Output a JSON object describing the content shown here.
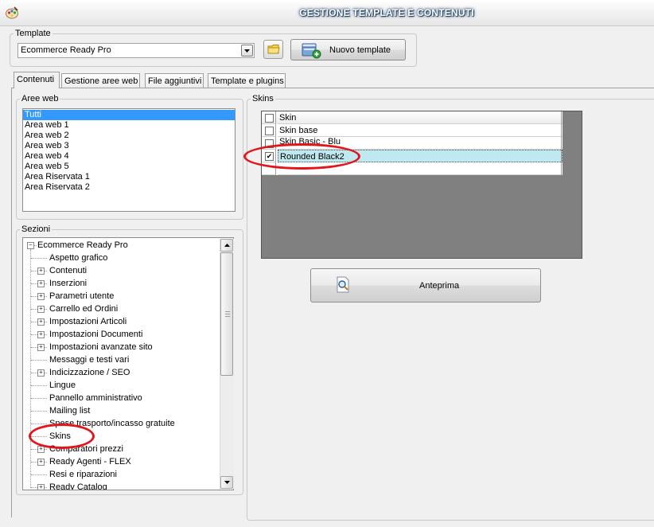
{
  "window": {
    "title": "GESTIONE TEMPLATE E CONTENUTI",
    "icon": "app-palette-icon"
  },
  "template_group": {
    "legend": "Template",
    "combo_value": "Ecommerce Ready Pro",
    "folder_icon": "folder-icon",
    "new_button_label": "Nuovo template",
    "new_button_icon": "new-template-icon"
  },
  "tabs": [
    {
      "label": "Contenuti",
      "active": true
    },
    {
      "label": "Gestione aree web",
      "active": false
    },
    {
      "label": "File aggiuntivi",
      "active": false
    },
    {
      "label": "Template e plugins",
      "active": false
    }
  ],
  "aree_web": {
    "legend": "Aree web",
    "items": [
      {
        "label": "Tutti",
        "selected": true
      },
      {
        "label": "Area web 1"
      },
      {
        "label": "Area web 2"
      },
      {
        "label": "Area web 3"
      },
      {
        "label": "Area web 4"
      },
      {
        "label": "Area web 5"
      },
      {
        "label": "Area Riservata 1"
      },
      {
        "label": "Area Riservata 2"
      }
    ]
  },
  "sezioni": {
    "legend": "Sezioni",
    "root": "Ecommerce Ready Pro",
    "items": [
      {
        "label": "Aspetto grafico",
        "expandable": false
      },
      {
        "label": "Contenuti",
        "expandable": true
      },
      {
        "label": "Inserzioni",
        "expandable": true
      },
      {
        "label": "Parametri utente",
        "expandable": true
      },
      {
        "label": "Carrello ed Ordini",
        "expandable": true
      },
      {
        "label": "Impostazioni Articoli",
        "expandable": true
      },
      {
        "label": "Impostazioni Documenti",
        "expandable": true
      },
      {
        "label": "Impostazioni avanzate sito",
        "expandable": true
      },
      {
        "label": "Messaggi e testi vari",
        "expandable": false
      },
      {
        "label": "Indicizzazione / SEO",
        "expandable": true
      },
      {
        "label": "Lingue",
        "expandable": false
      },
      {
        "label": "Pannello amministrativo",
        "expandable": false
      },
      {
        "label": "Mailing list",
        "expandable": false
      },
      {
        "label": "Spese trasporto/incasso gratuite",
        "expandable": false
      },
      {
        "label": "Skins",
        "expandable": false
      },
      {
        "label": "Comparatori prezzi",
        "expandable": true
      },
      {
        "label": "Ready Agenti - FLEX",
        "expandable": true
      },
      {
        "label": "Resi e riparazioni",
        "expandable": false
      },
      {
        "label": "Ready Catalog",
        "expandable": true
      }
    ]
  },
  "skins": {
    "legend": "Skins",
    "header": "Skin",
    "rows": [
      {
        "label": "Skin base",
        "checked": false
      },
      {
        "label": "Skin Basic - Blu",
        "checked": false
      },
      {
        "label": "Rounded Black2",
        "checked": true
      }
    ],
    "preview_button_label": "Anteprima",
    "preview_icon": "preview-magnifier-icon"
  },
  "annotation_color": "#e4141b",
  "selection_color": "#3399ff"
}
